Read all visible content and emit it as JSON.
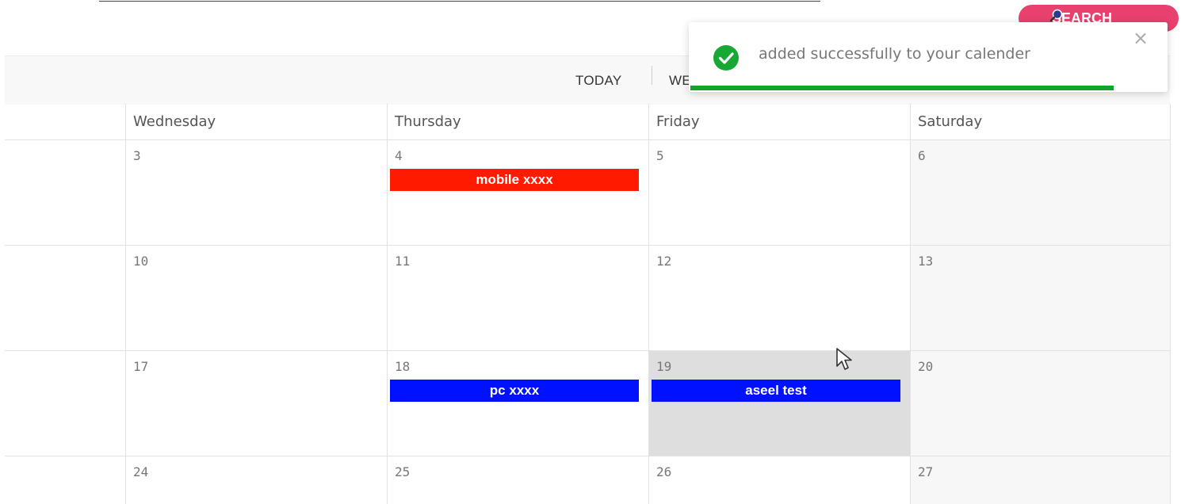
{
  "search": {
    "label": "SEARCH",
    "icon": "search-icon",
    "color": "#e8416f"
  },
  "toolbar": {
    "today_label": "TODAY",
    "week_label_partial": "WE"
  },
  "calendar": {
    "headers": [
      "Wednesday",
      "Thursday",
      "Friday",
      "Saturday"
    ],
    "weeks": [
      {
        "days": [
          "3",
          "4",
          "5",
          "6"
        ]
      },
      {
        "days": [
          "10",
          "11",
          "12",
          "13"
        ]
      },
      {
        "days": [
          "17",
          "18",
          "19",
          "20"
        ]
      },
      {
        "days": [
          "24",
          "25",
          "26",
          "27"
        ]
      }
    ],
    "events": [
      {
        "title": "mobile xxxx",
        "color": "#ff1a00",
        "day": "4"
      },
      {
        "title": "pc xxxx",
        "color": "#0011ff",
        "day": "18"
      },
      {
        "title": "aseel test",
        "color": "#0011ff",
        "day": "19"
      }
    ],
    "highlighted_day": "19"
  },
  "toast": {
    "message": "added successfully to your calender",
    "close": "×",
    "icon": "check-circle-icon",
    "progress": 0.89,
    "accent": "#11a52b"
  }
}
